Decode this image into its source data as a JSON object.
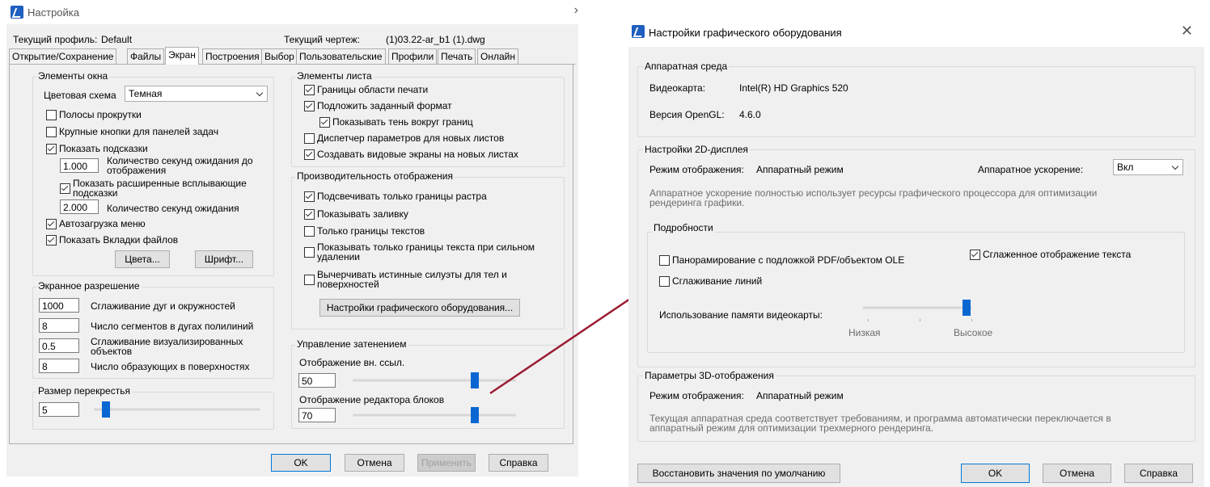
{
  "left": {
    "title": "Настройка",
    "profile_label": "Текущий профиль:",
    "profile_value": "Default",
    "drawing_label": "Текущий чертеж:",
    "drawing_value": "(1)03.22-ar_b1 (1).dwg",
    "tabs": [
      "Открытие/Сохранение",
      "Файлы",
      "Экран",
      "Построения",
      "Выбор",
      "Пользовательские",
      "Профили",
      "Печать",
      "Онлайн"
    ],
    "window_elements": {
      "title": "Элементы окна",
      "color_scheme_label": "Цветовая схема",
      "color_scheme_value": "Темная",
      "scrollbars": "Полосы прокрутки",
      "large_buttons": "Крупные кнопки для панелей задач",
      "show_tooltips": "Показать подсказки",
      "delay_value": "1.000",
      "delay_label": "Количество секунд ожидания до отображения",
      "ext_tooltips": "Показать расширенные всплывающие подсказки",
      "ext_delay_value": "2.000",
      "ext_delay_label": "Количество секунд ожидания",
      "autoload_menu": "Автозагрузка меню",
      "file_tabs": "Показать Вкладки файлов",
      "colors_btn": "Цвета...",
      "font_btn": "Шрифт..."
    },
    "resolution": {
      "title": "Экранное разрешение",
      "rows": [
        {
          "value": "1000",
          "label": "Сглаживание дуг и окружностей"
        },
        {
          "value": "8",
          "label": "Число сегментов в дугах полилиний"
        },
        {
          "value": "0.5",
          "label": "Сглаживание визуализированных объектов"
        },
        {
          "value": "8",
          "label": "Число образующих в поверхностях"
        }
      ]
    },
    "crosshair": {
      "title": "Размер перекрестья",
      "value": "5",
      "level_percent": 5
    },
    "sheet_elements": {
      "title": "Элементы листа",
      "items": [
        "Границы области печати",
        "Подложить заданный формат",
        "Показывать тень вокруг границ",
        "Диспетчер параметров для новых листов",
        "Создавать видовые экраны на новых листах"
      ]
    },
    "performance": {
      "title": "Производительность отображения",
      "items": [
        "Подсвечивать только границы растра",
        "Показывать заливку",
        "Только границы текстов",
        "Показывать только границы текста при сильном удалении",
        "Вычерчивать истинные силуэты для тел и поверхностей"
      ],
      "hw_button": "Настройки графического оборудования..."
    },
    "fade": {
      "title": "Управление затенением",
      "xref_label": "Отображение вн. ссыл.",
      "xref_value": "50",
      "block_label": "Отображение редактора блоков",
      "block_value": "70",
      "xref_level_percent": 77,
      "block_level_percent": 77
    },
    "buttons": {
      "ok": "OK",
      "cancel": "Отмена",
      "apply": "Применить",
      "help": "Справка"
    }
  },
  "right": {
    "title": "Настройки графического оборудования",
    "hw_env": {
      "title": "Аппаратная среда",
      "video_label": "Видеокарта:",
      "video_value": "Intel(R) HD Graphics 520",
      "opengl_label": "Версия OpenGL:",
      "opengl_value": "4.6.0"
    },
    "display2d": {
      "title": "Настройки 2D-дисплея",
      "mode_label": "Режим отображения:",
      "mode_value": "Аппаратный режим",
      "accel_label": "Аппаратное ускорение:",
      "accel_value": "Вкл",
      "note": "Аппаратное ускорение полностью использует ресурсы графического процессора для оптимизации рендеринга графики.",
      "details": {
        "title": "Подробности",
        "pdf_pan": "Панорамирование с подложкой PDF/объектом OLE",
        "smooth_text": "Сглаженное отображение текста",
        "line_smooth": "Сглаживание линий",
        "memory_label": "Использование памяти видеокарты:",
        "low": "Низкая",
        "high": "Высокое",
        "memory_level_percent": 100
      }
    },
    "display3d": {
      "title": "Параметры 3D-отображения",
      "mode_label": "Режим отображения:",
      "mode_value": "Аппаратный режим",
      "note": "Текущая аппаратная среда соответствует требованиям, и программа автоматически переключается в аппаратный режим для оптимизации трехмерного рендеринга."
    },
    "buttons": {
      "restore": "Восстановить значения по умолчанию",
      "ok": "OK",
      "cancel": "Отмена",
      "help": "Справка"
    }
  },
  "colors": {
    "arrow": "#9b1b30",
    "slider": "#0a67d1",
    "accent": "#0078d7"
  }
}
